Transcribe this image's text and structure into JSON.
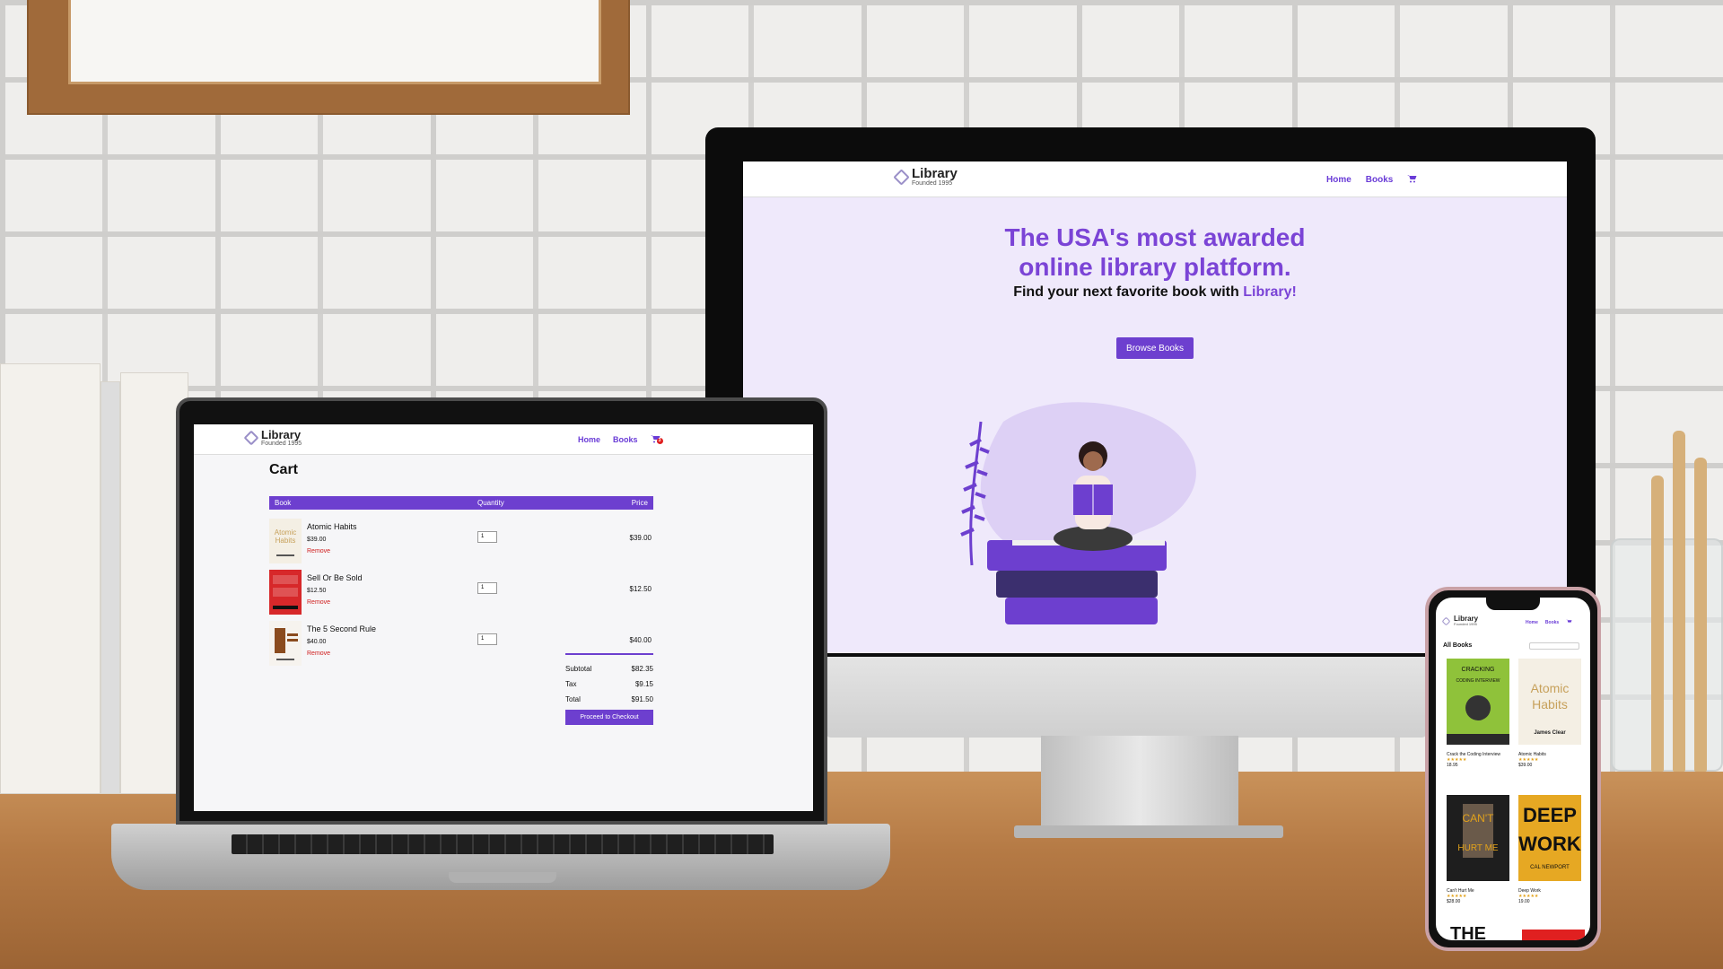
{
  "site": {
    "logo_title": "Library",
    "logo_subtitle": "Founded 1995",
    "nav_home": "Home",
    "nav_books": "Books",
    "cart_badge": "3",
    "accent_color": "#6d3fcf"
  },
  "desktop": {
    "hero_line1": "The USA's most awarded",
    "hero_line2": "online library platform.",
    "hero_sub_prefix": "Find your next favorite book with ",
    "hero_sub_accent": "Library!",
    "browse_button": "Browse Books"
  },
  "laptop": {
    "cart_title": "Cart",
    "columns": {
      "book": "Book",
      "quantity": "Quantity",
      "price": "Price"
    },
    "items": [
      {
        "title": "Atomic Habits",
        "price": "$39.00",
        "remove": "Remove",
        "qty": "1",
        "total": "$39.00"
      },
      {
        "title": "Sell Or Be Sold",
        "price": "$12.50",
        "remove": "Remove",
        "qty": "1",
        "total": "$12.50"
      },
      {
        "title": "The 5 Second Rule",
        "price": "$40.00",
        "remove": "Remove",
        "qty": "1",
        "total": "$40.00"
      }
    ],
    "summary": {
      "subtotal_label": "Subtotal",
      "subtotal": "$82.35",
      "tax_label": "Tax",
      "tax": "$9.15",
      "total_label": "Total",
      "total": "$91.50"
    },
    "checkout_button": "Proceed to Checkout"
  },
  "phone": {
    "heading": "All Books",
    "books": [
      {
        "cover_title": "CRACKING",
        "cover_title2": "CODING INTERVIEW",
        "name": "Crack the Coding Interview",
        "stars": "★★★★★",
        "price": "18.95"
      },
      {
        "cover_title": "Atomic",
        "cover_title2": "Habits",
        "cover_author": "James Clear",
        "name": "Atomic Habits",
        "stars": "★★★★★",
        "price": "$39.00"
      },
      {
        "cover_title": "CAN'T",
        "cover_title2": "HURT ME",
        "name": "Can't Hurt Me",
        "stars": "★★★★★",
        "price": "$28.00"
      },
      {
        "cover_title": "DEEP",
        "cover_title2": "WORK",
        "cover_author": "CAL NEWPORT",
        "name": "Deep Work",
        "stars": "★★★★★",
        "price": "19.00"
      }
    ],
    "partial_cover": "THE"
  }
}
